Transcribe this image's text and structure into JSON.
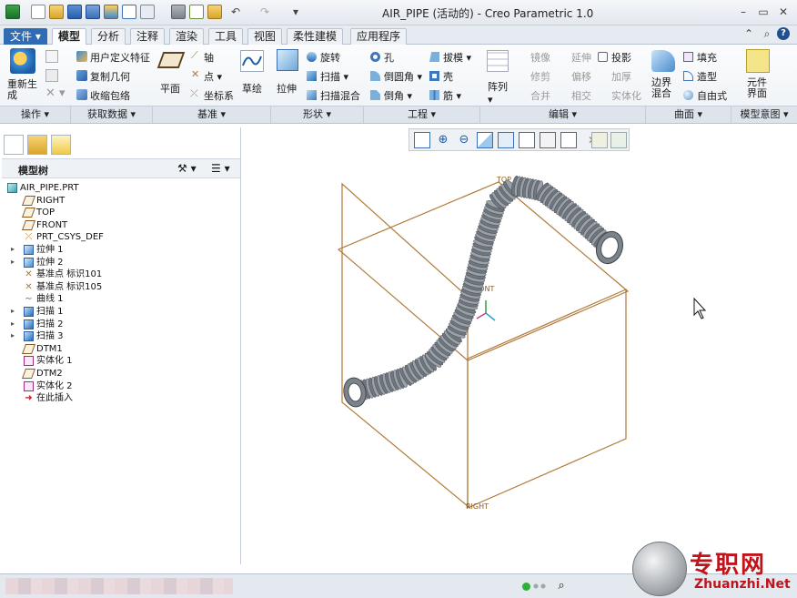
{
  "window": {
    "title": "AIR_PIPE (活动的) - Creo Parametric 1.0"
  },
  "tabs": [
    {
      "label": "文件",
      "id": "file"
    },
    {
      "label": "模型",
      "id": "model"
    },
    {
      "label": "分析",
      "id": "analysis"
    },
    {
      "label": "注释",
      "id": "annotate"
    },
    {
      "label": "渲染",
      "id": "render"
    },
    {
      "label": "工具",
      "id": "tools"
    },
    {
      "label": "视图",
      "id": "view"
    },
    {
      "label": "柔性建模",
      "id": "flexible"
    },
    {
      "label": "应用程序",
      "id": "apps"
    }
  ],
  "ribbon": {
    "operations": {
      "regen": "重新生成",
      "group": "操作"
    },
    "get_data": {
      "udf": "用户定义特征",
      "copy_geom": "复制几何",
      "shrinkwrap": "收缩包络",
      "group": "获取数据"
    },
    "datum": {
      "plane": "平面",
      "axis": "轴",
      "point": "点",
      "csys": "坐标系",
      "sketch": "草绘",
      "group": "基准"
    },
    "shapes": {
      "extrude": "拉伸",
      "revolve": "旋转",
      "sweep": "扫描",
      "swept_blend": "扫描混合",
      "group": "形状"
    },
    "engineering": {
      "hole": "孔",
      "round": "倒圆角",
      "chamfer": "倒角",
      "draft": "拔模",
      "shell": "壳",
      "rib": "筋",
      "group": "工程"
    },
    "editing": {
      "pattern": "阵列",
      "mirror": "镜像",
      "trim": "修剪",
      "merge": "合并",
      "extend": "延伸",
      "offset": "偏移",
      "intersect": "相交",
      "project": "投影",
      "thicken": "加厚",
      "solidify": "实体化",
      "group": "编辑"
    },
    "surfaces": {
      "boundary_blend": "边界混合",
      "fill": "填充",
      "style": "造型",
      "freestyle": "自由式",
      "group": "曲面"
    },
    "model_intent": {
      "component_interface": "元件界面",
      "group": "模型意图"
    }
  },
  "model_tree": {
    "title": "模型树",
    "items": [
      {
        "label": "AIR_PIPE.PRT",
        "icon": "part-icon",
        "expandable": false,
        "indent": 0
      },
      {
        "label": "RIGHT",
        "icon": "datum-plane-icon",
        "expandable": false,
        "indent": 1
      },
      {
        "label": "TOP",
        "icon": "datum-plane-icon",
        "expandable": false,
        "indent": 1
      },
      {
        "label": "FRONT",
        "icon": "datum-plane-icon",
        "expandable": false,
        "indent": 1
      },
      {
        "label": "PRT_CSYS_DEF",
        "icon": "csys-icon",
        "expandable": false,
        "indent": 1
      },
      {
        "label": "拉伸 1",
        "icon": "extrude-icon",
        "expandable": true,
        "indent": 1
      },
      {
        "label": "拉伸 2",
        "icon": "extrude-icon",
        "expandable": true,
        "indent": 1
      },
      {
        "label": "基准点 标识101",
        "icon": "datum-point-icon",
        "expandable": false,
        "indent": 1
      },
      {
        "label": "基准点 标识105",
        "icon": "datum-point-icon",
        "expandable": false,
        "indent": 1
      },
      {
        "label": "曲线 1",
        "icon": "curve-icon",
        "expandable": false,
        "indent": 1
      },
      {
        "label": "扫描 1",
        "icon": "sweep-icon",
        "expandable": true,
        "indent": 1
      },
      {
        "label": "扫描 2",
        "icon": "sweep-icon",
        "expandable": true,
        "indent": 1
      },
      {
        "label": "扫描 3",
        "icon": "sweep-icon",
        "expandable": true,
        "indent": 1
      },
      {
        "label": "DTM1",
        "icon": "datum-plane-icon",
        "expandable": false,
        "indent": 1
      },
      {
        "label": "实体化 1",
        "icon": "solidify-icon",
        "expandable": false,
        "indent": 1
      },
      {
        "label": "DTM2",
        "icon": "datum-plane-icon",
        "expandable": false,
        "indent": 1
      },
      {
        "label": "实体化 2",
        "icon": "solidify-icon",
        "expandable": false,
        "indent": 1
      },
      {
        "label": "在此插入",
        "icon": "insert-here-icon",
        "expandable": false,
        "indent": 1
      }
    ]
  },
  "viewport": {
    "plane_labels": {
      "top": "TOP",
      "front": "FRONT",
      "right": "RIGHT"
    }
  },
  "colors": {
    "accent": "#2f6cb3",
    "datum_plane": "#b07a3a",
    "pipe": "#8e959c",
    "insert_arrow": "#c0141b"
  },
  "watermark": {
    "brand": "专职网",
    "url": "Zhuanzhi.Net"
  }
}
